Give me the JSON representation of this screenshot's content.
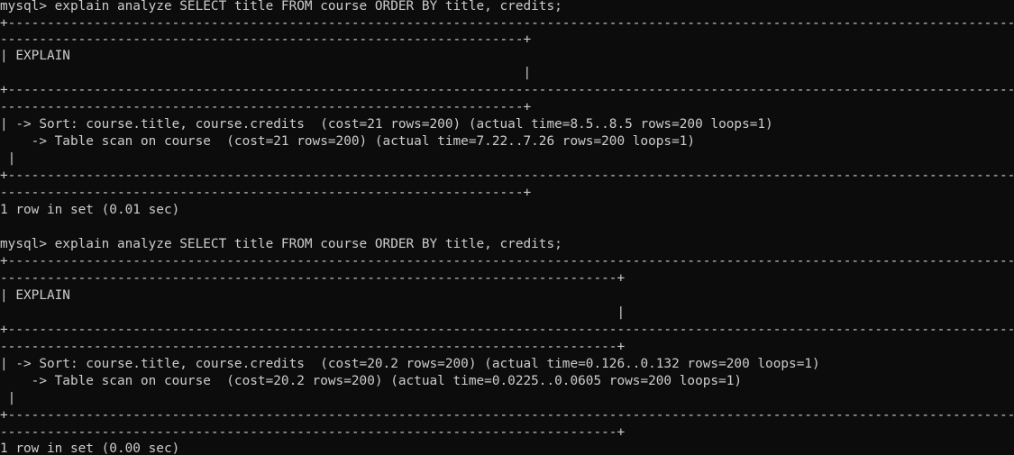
{
  "terminal": {
    "colors": {
      "background": "#0c0c0c",
      "foreground": "#cccccc"
    },
    "lines": [
      "mysql> explain analyze SELECT title FROM course ORDER BY title, credits;",
      "+--------------------------------------------------------------------------------------------------------------------------------------------------------",
      "-------------------------------------------------------------------+",
      "| EXPLAIN",
      "                                                                   |",
      "+--------------------------------------------------------------------------------------------------------------------------------------------------------",
      "-------------------------------------------------------------------+",
      "| -> Sort: course.title, course.credits  (cost=21 rows=200) (actual time=8.5..8.5 rows=200 loops=1)",
      "    -> Table scan on course  (cost=21 rows=200) (actual time=7.22..7.26 rows=200 loops=1)",
      " |",
      "+--------------------------------------------------------------------------------------------------------------------------------------------------------",
      "-------------------------------------------------------------------+",
      "1 row in set (0.01 sec)",
      "",
      "mysql> explain analyze SELECT title FROM course ORDER BY title, credits;",
      "+--------------------------------------------------------------------------------------------------------------------------------------------------------",
      "-------------------------------------------------------------------------------+",
      "| EXPLAIN",
      "                                                                               |",
      "+--------------------------------------------------------------------------------------------------------------------------------------------------------",
      "-------------------------------------------------------------------------------+",
      "| -> Sort: course.title, course.credits  (cost=20.2 rows=200) (actual time=0.126..0.132 rows=200 loops=1)",
      "    -> Table scan on course  (cost=20.2 rows=200) (actual time=0.0225..0.0605 rows=200 loops=1)",
      " |",
      "+--------------------------------------------------------------------------------------------------------------------------------------------------------",
      "-------------------------------------------------------------------------------+",
      "1 row in set (0.00 sec)"
    ]
  }
}
